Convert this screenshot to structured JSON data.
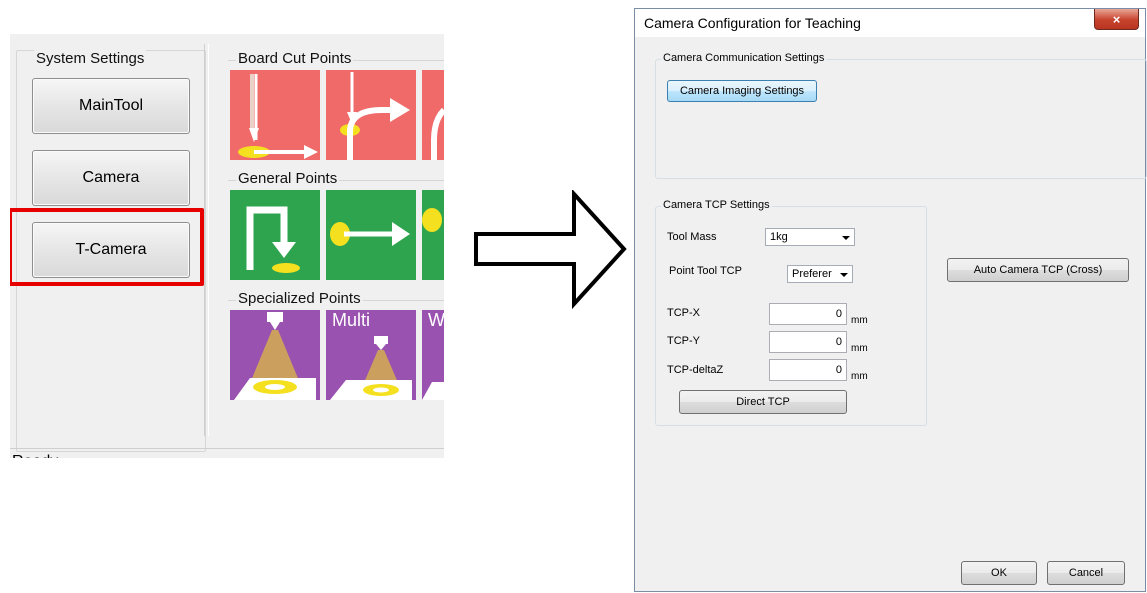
{
  "left_panel": {
    "system_settings_label": "System Settings",
    "buttons": [
      {
        "label": "MainTool"
      },
      {
        "label": "Camera"
      },
      {
        "label": "T-Camera"
      }
    ],
    "groups": {
      "board_cut": "Board Cut Points",
      "general": "General Points",
      "specialized": "Specialized Points"
    },
    "tile_texts": {
      "multi": "Multi",
      "partial": "W"
    },
    "status": "Ready",
    "highlight_color": "#e60000"
  },
  "dialog": {
    "title": "Camera Configuration for Teaching",
    "close_icon": "×",
    "comm_group": {
      "label": "Camera Communication Settings",
      "imaging_button": "Camera Imaging Settings"
    },
    "tcp_group": {
      "label": "Camera TCP Settings",
      "tool_mass_label": "Tool Mass",
      "tool_mass_value": "1kg",
      "point_tool_tcp_label": "Point Tool TCP",
      "point_tool_tcp_value": "Preferer",
      "tcp_x_label": "TCP-X",
      "tcp_x_value": "0",
      "tcp_y_label": "TCP-Y",
      "tcp_y_value": "0",
      "tcp_dz_label": "TCP-deltaZ",
      "tcp_dz_value": "0",
      "unit": "mm",
      "direct_tcp_button": "Direct TCP"
    },
    "auto_tcp_button": "Auto Camera TCP (Cross)",
    "ok_button": "OK",
    "cancel_button": "Cancel"
  }
}
